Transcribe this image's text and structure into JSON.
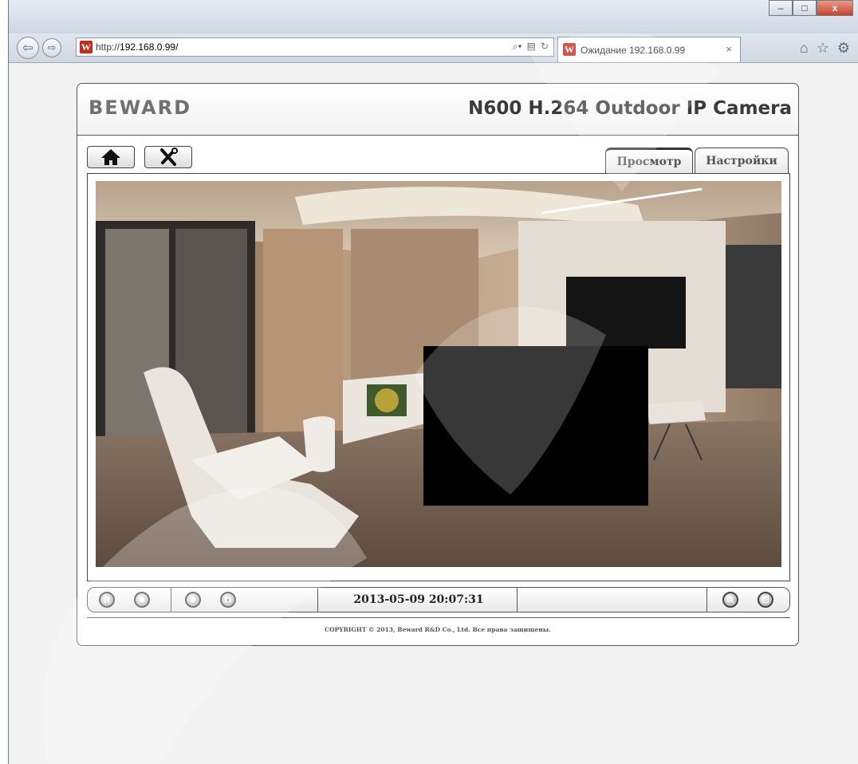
{
  "browser": {
    "url_prefix": "http://",
    "url_host": "192.168.0.99/",
    "tab_title": "Ожидание 192.168.0.99",
    "favicon_letter": "W",
    "tab_close": "×",
    "window_controls": {
      "minimize": "‒",
      "maximize": "□",
      "close": "x"
    }
  },
  "camera_page": {
    "logo": "BEWARD",
    "model_title": "N600 H.264 Outdoor IP Camera",
    "tabs": [
      "Просмотр",
      "Настройки"
    ],
    "active_tab": "Просмотр",
    "timestamp": "2013-05-09 20:07:31",
    "copyright": "COPYRIGHT © 2013, Beward R&D Co., Ltd. Все права защищены."
  },
  "icons": [
    "back-icon",
    "forward-icon",
    "search-icon",
    "refresh-icon",
    "home-icon",
    "star-icon",
    "gear-icon",
    "wrench-icon",
    "pause-icon",
    "stop-icon",
    "record-icon",
    "snapshot-icon",
    "zoom-icon",
    "fullscreen-icon"
  ],
  "colors": {
    "brand_red": "#c8281e",
    "panel_border": "#555555",
    "page_bg": "#f2f2f2"
  }
}
